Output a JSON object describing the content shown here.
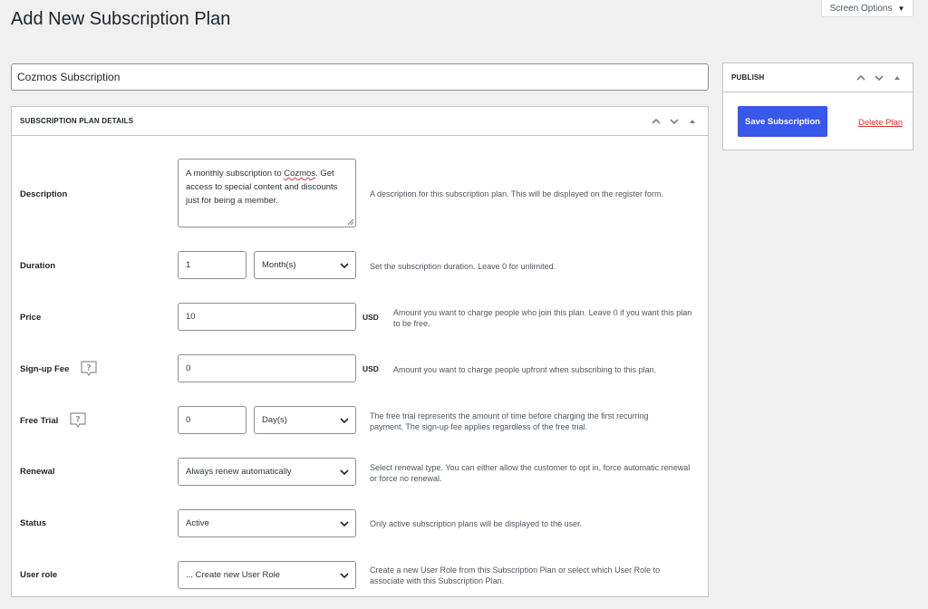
{
  "page": {
    "title": "Add New Subscription Plan",
    "screen_options_label": "Screen Options"
  },
  "plan": {
    "title_value": "Cozmos Subscription"
  },
  "details_box": {
    "title": "SUBSCRIPTION PLAN DETAILS",
    "description": {
      "label": "Description",
      "value_before": "A monthly subscription to ",
      "value_spell": "Cozmos",
      "value_after": ". Get access to special content and discounts just for being a member.",
      "help": "A description for this subscription plan. This will be displayed on the register form."
    },
    "duration": {
      "label": "Duration",
      "value": "1",
      "unit_selected": "Month(s)",
      "help": "Set the subscription duration. Leave 0 for unlimited."
    },
    "price": {
      "label": "Price",
      "value": "10",
      "currency": "USD",
      "help": "Amount you want to charge people who join this plan. Leave 0 if you want this plan to be free."
    },
    "signup_fee": {
      "label": "Sign-up Fee",
      "value": "0",
      "currency": "USD",
      "help": "Amount you want to charge people upfront when subscribing to this plan."
    },
    "free_trial": {
      "label": "Free Trial",
      "value": "0",
      "unit_selected": "Day(s)",
      "help": "The free trial represents the amount of time before charging the first recurring payment. The sign-up fee applies regardless of the free trial."
    },
    "renewal": {
      "label": "Renewal",
      "selected": "Always renew automatically",
      "help": "Select renewal type. You can either allow the customer to opt in, force automatic renewal or force no renewal."
    },
    "status": {
      "label": "Status",
      "selected": "Active",
      "help": "Only active subscription plans will be displayed to the user."
    },
    "user_role": {
      "label": "User role",
      "selected": "... Create new User Role",
      "help": "Create a new User Role from this Subscription Plan or select which User Role to associate with this Subscription Plan."
    }
  },
  "publish_box": {
    "title": "PUBLISH",
    "save_label": "Save Subscription",
    "delete_label": "Delete Plan"
  },
  "colors": {
    "primary_button": "#3858e9",
    "delete_link": "#d63638",
    "background": "#f0f0f1"
  }
}
